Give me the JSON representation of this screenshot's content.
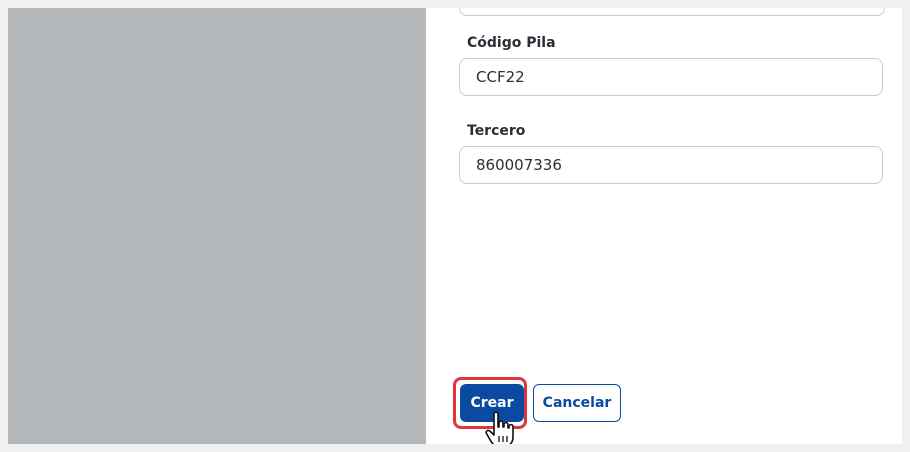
{
  "form": {
    "fields": [
      {
        "label": "Código Pila",
        "value": "CCF22"
      },
      {
        "label": "Tercero",
        "value": "860007336"
      }
    ]
  },
  "actions": {
    "create_label": "Crear",
    "cancel_label": "Cancelar"
  },
  "colors": {
    "primary": "#0a4aa0",
    "highlight_ring": "#e0343f",
    "overlay": "#b4b7ba"
  },
  "icons": {
    "cursor": "hand-pointer-icon"
  }
}
